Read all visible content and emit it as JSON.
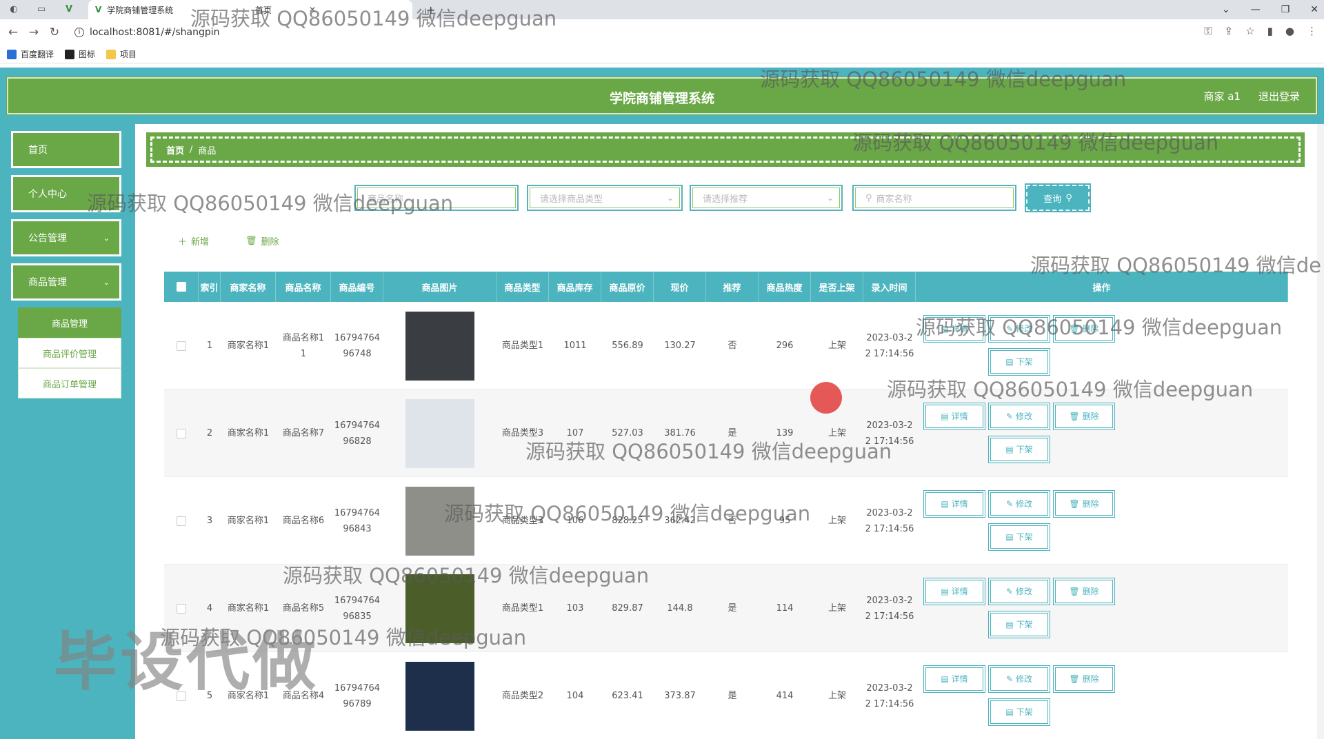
{
  "browser": {
    "tab_title": "学院商铺管理系统",
    "tab2_title": "首页",
    "url": "localhost:8081/#/shangpin",
    "bookmarks": [
      "百度翻译",
      "图标",
      "项目"
    ]
  },
  "app": {
    "title": "学院商铺管理系统",
    "user_label": "商家 a1",
    "logout_label": "退出登录"
  },
  "sidebar": {
    "items": [
      {
        "label": "首页"
      },
      {
        "label": "个人中心"
      },
      {
        "label": "公告管理"
      },
      {
        "label": "商品管理"
      }
    ],
    "submenu": [
      {
        "label": "商品管理"
      },
      {
        "label": "商品评价管理"
      },
      {
        "label": "商品订单管理"
      }
    ]
  },
  "breadcrumb": {
    "home": "首页",
    "sep": "/",
    "current": "商品"
  },
  "search": {
    "name_placeholder": "商品名称",
    "type_placeholder": "请选择商品类型",
    "recommend_placeholder": "请选择推荐",
    "merchant_placeholder": "商家名称",
    "query_label": "查询"
  },
  "actions": {
    "add_label": "新增",
    "delete_label": "删除"
  },
  "table": {
    "headers": [
      "索引",
      "商家名称",
      "商品名称",
      "商品编号",
      "商品图片",
      "商品类型",
      "商品库存",
      "商品原价",
      "现价",
      "推荐",
      "商品热度",
      "是否上架",
      "录入时间",
      "操作"
    ],
    "rows": [
      {
        "index": "1",
        "merchant": "商家名称1",
        "name1": "商品名称1",
        "name2": "1",
        "code1": "16794764",
        "code2": "96748",
        "type": "商品类型1",
        "stock": "1011",
        "orig": "556.89",
        "price": "130.27",
        "rec": "否",
        "heat": "296",
        "onsale": "上架",
        "time1": "2023-03-2",
        "time2": "2 17:14:56",
        "img_color": "#3a3d42"
      },
      {
        "index": "2",
        "merchant": "商家名称1",
        "name1": "商品名称7",
        "name2": "",
        "code1": "16794764",
        "code2": "96828",
        "type": "商品类型3",
        "stock": "107",
        "orig": "527.03",
        "price": "381.76",
        "rec": "是",
        "heat": "139",
        "onsale": "上架",
        "time1": "2023-03-2",
        "time2": "2 17:14:56",
        "img_color": "#dfe4ea"
      },
      {
        "index": "3",
        "merchant": "商家名称1",
        "name1": "商品名称6",
        "name2": "",
        "code1": "16794764",
        "code2": "96843",
        "type": "商品类型3",
        "stock": "106",
        "orig": "828.25",
        "price": "362.42",
        "rec": "否",
        "heat": "95",
        "onsale": "上架",
        "time1": "2023-03-2",
        "time2": "2 17:14:56",
        "img_color": "#8f8f8a"
      },
      {
        "index": "4",
        "merchant": "商家名称1",
        "name1": "商品名称5",
        "name2": "",
        "code1": "16794764",
        "code2": "96835",
        "type": "商品类型1",
        "stock": "103",
        "orig": "829.87",
        "price": "144.8",
        "rec": "是",
        "heat": "114",
        "onsale": "上架",
        "time1": "2023-03-2",
        "time2": "2 17:14:56",
        "img_color": "#4b5e2a"
      },
      {
        "index": "5",
        "merchant": "商家名称1",
        "name1": "商品名称4",
        "name2": "",
        "code1": "16794764",
        "code2": "96789",
        "type": "商品类型2",
        "stock": "104",
        "orig": "623.41",
        "price": "373.87",
        "rec": "是",
        "heat": "414",
        "onsale": "上架",
        "time1": "2023-03-2",
        "time2": "2 17:14:56",
        "img_color": "#1d2f4a"
      }
    ],
    "op_detail": "详情",
    "op_edit": "修改",
    "op_delete": "删除",
    "op_offshelf": "下架"
  },
  "watermarks": {
    "text": "源码获取 QQ86050149 微信deepguan",
    "partial": "源码获取 QQ86050149 微信de",
    "big": "毕设代做"
  },
  "colors": {
    "primary_green": "#6aa847",
    "teal": "#4bb4bf"
  }
}
